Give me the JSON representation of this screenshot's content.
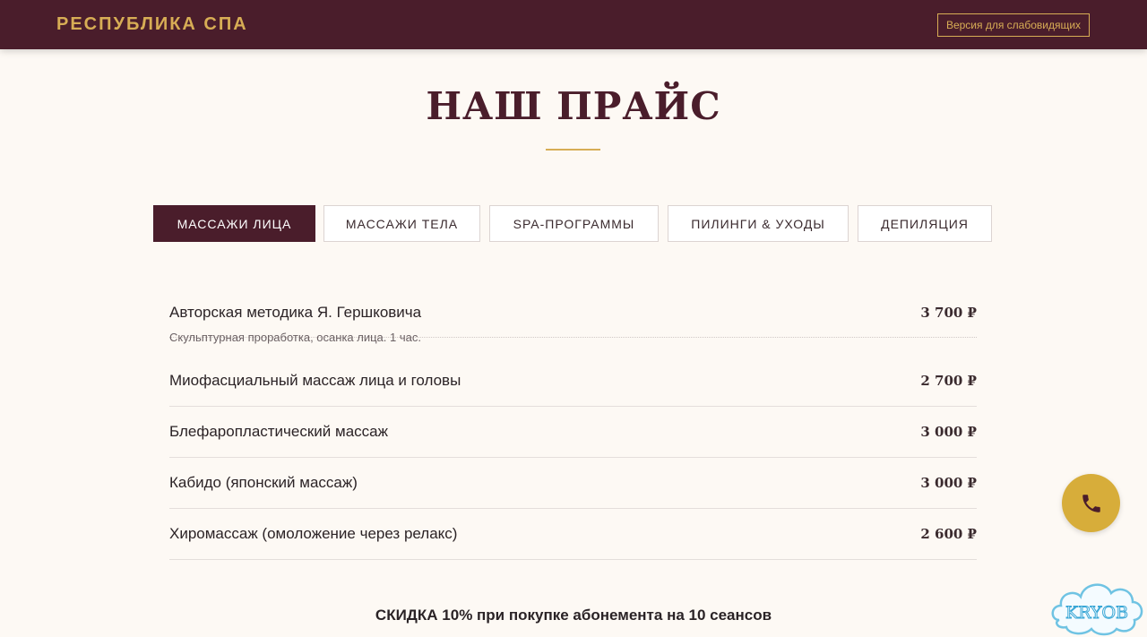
{
  "header": {
    "logo": "РЕСПУБЛИКА СПА",
    "accessibility_button": "Версия для слабовидящих",
    "background_color": "#4a1d2b",
    "accent_color": "#d7ad55"
  },
  "main": {
    "title": "НАШ ПРАЙС",
    "tabs": [
      {
        "label": "МАССАЖИ ЛИЦА",
        "active": true
      },
      {
        "label": "МАССАЖИ ТЕЛА",
        "active": false
      },
      {
        "label": "SPA-ПРОГРАММЫ",
        "active": false
      },
      {
        "label": "ПИЛИНГИ & УХОДЫ",
        "active": false
      },
      {
        "label": "ДЕПИЛЯЦИЯ",
        "active": false
      }
    ],
    "items": [
      {
        "name": "Авторская методика Я. Гершковича",
        "description": "Скульптурная проработка, осанка лица. 1 час.",
        "price": "3 700 ₽"
      },
      {
        "name": "Миофасциальный массаж лица и головы",
        "price": "2 700 ₽"
      },
      {
        "name": "Блефаропластический массаж",
        "price": "3 000 ₽"
      },
      {
        "name": "Кабидо (японский массаж)",
        "price": "3 000 ₽"
      },
      {
        "name": "Хиромассаж (омоложение через релакс)",
        "price": "2 600 ₽"
      }
    ],
    "discount": "СКИДКА 10% при покупке абонемента на 10 сеансов"
  },
  "floating": {
    "phone_icon": "phone-icon",
    "phone_color": "#d7ad3a"
  },
  "watermark": {
    "text": "KRYOB"
  }
}
